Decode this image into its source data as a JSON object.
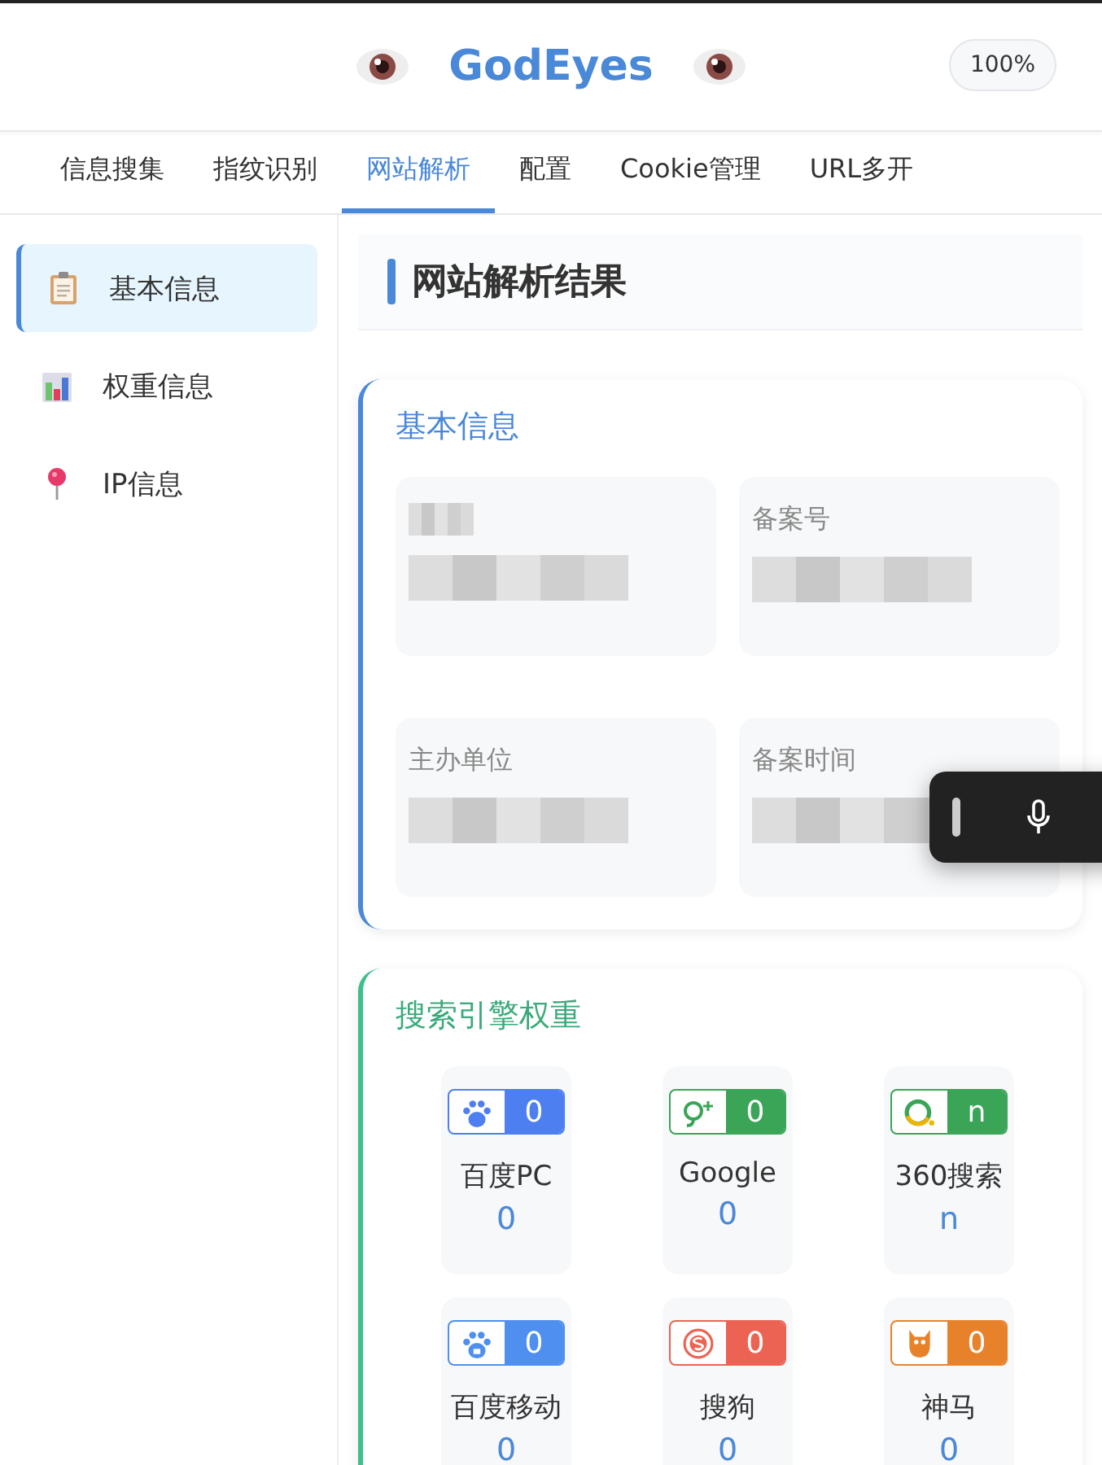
{
  "header": {
    "title": "GodEyes",
    "zoom": "100%"
  },
  "tabs": [
    {
      "label": "信息搜集",
      "selected": false
    },
    {
      "label": "指纹识别",
      "selected": false
    },
    {
      "label": "网站解析",
      "selected": true
    },
    {
      "label": "配置",
      "selected": false
    },
    {
      "label": "Cookie管理",
      "selected": false
    },
    {
      "label": "URL多开",
      "selected": false
    }
  ],
  "sidebar": {
    "items": [
      {
        "label": "基本信息",
        "kind": "clipboard",
        "selected": true
      },
      {
        "label": "权重信息",
        "kind": "chart",
        "selected": false
      },
      {
        "label": "IP信息",
        "kind": "pin",
        "selected": false
      }
    ]
  },
  "page_title": "网站解析结果",
  "basic_info": {
    "title": "基本信息",
    "fields": [
      {
        "kind": "redacted"
      },
      {
        "label": "备案号",
        "kind": "redacted"
      },
      {
        "label": "主办单位",
        "kind": "redacted"
      },
      {
        "label": "备案时间",
        "kind": "redacted"
      }
    ]
  },
  "weights": {
    "title": "搜索引擎权重",
    "engines": [
      {
        "name": "百度PC",
        "kind": "paw",
        "color": "#4e7ff0",
        "badge": "0",
        "value": "0"
      },
      {
        "name": "Google",
        "kind": "gplus",
        "color": "#3aa457",
        "badge": "0",
        "value": "0"
      },
      {
        "name": "360搜索",
        "kind": "ring",
        "color": "#3aa457",
        "badge": "n",
        "value": "n"
      },
      {
        "name": "百度移动",
        "kind": "pawm",
        "color": "#4e8ff0",
        "badge": "0",
        "value": "0"
      },
      {
        "name": "搜狗",
        "kind": "sogou",
        "color": "#ec6353",
        "badge": "0",
        "value": "0"
      },
      {
        "name": "神马",
        "kind": "owl",
        "color": "#e8822a",
        "badge": "0",
        "value": "0"
      }
    ]
  }
}
